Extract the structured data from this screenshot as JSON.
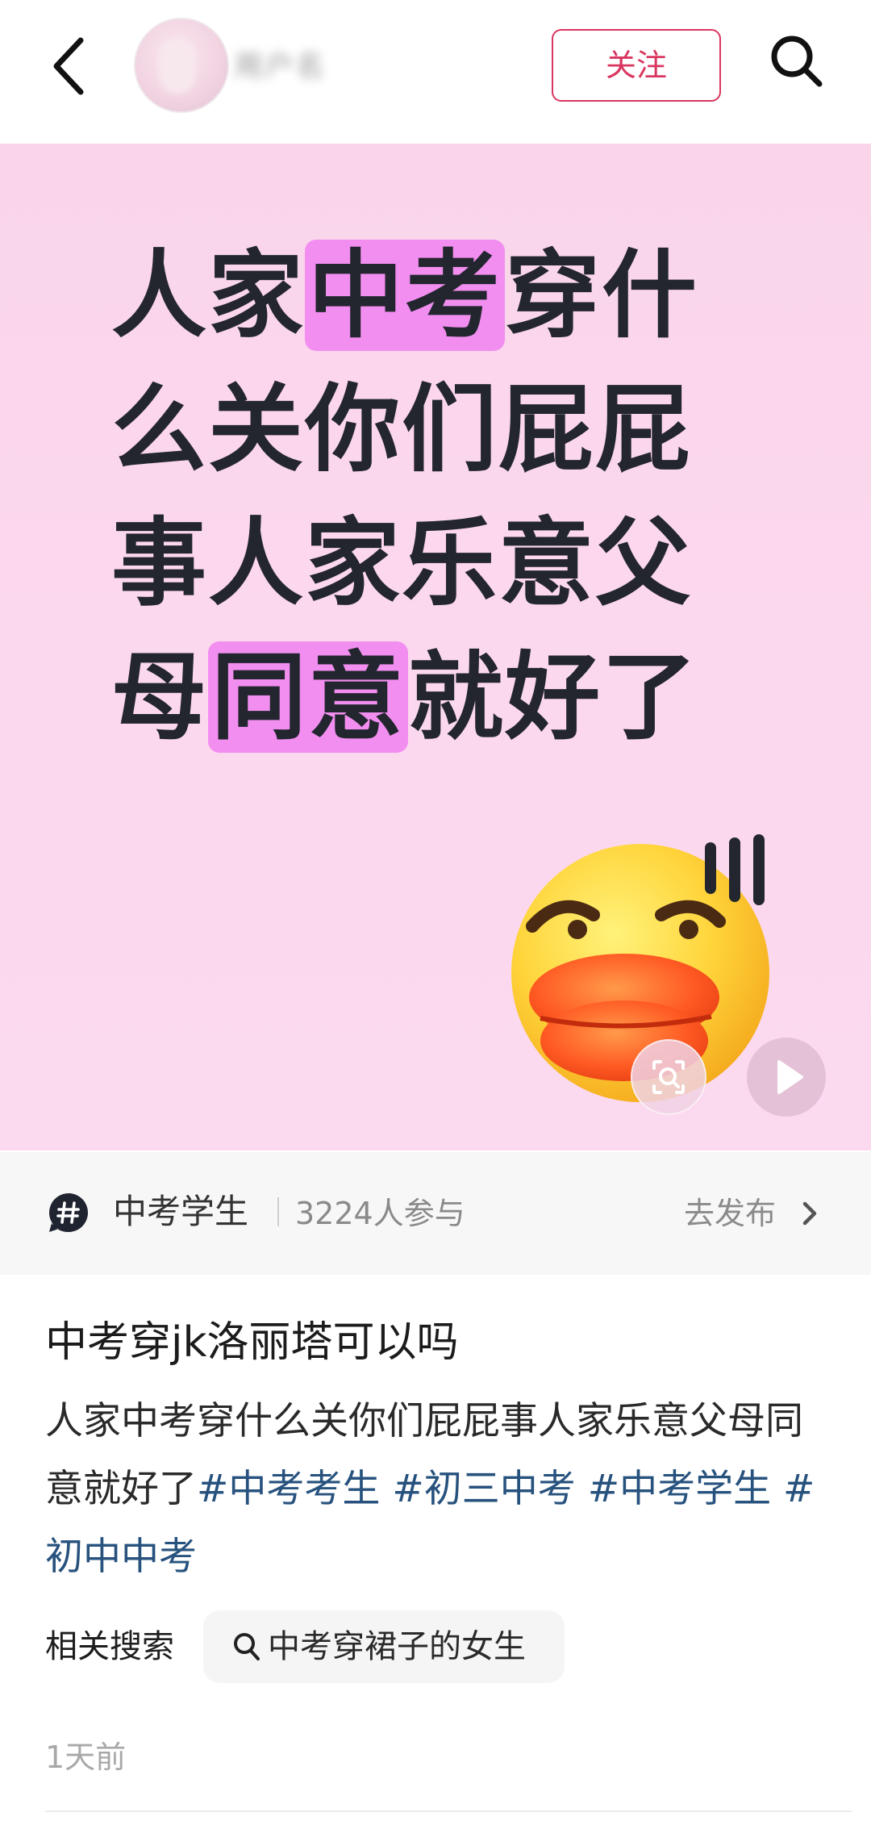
{
  "header": {
    "username": "用户名",
    "follow_label": "关注"
  },
  "hero": {
    "lines": [
      [
        "人家",
        "中考",
        "穿什"
      ],
      [
        "么关你们屁屁"
      ],
      [
        "事人家乐意父"
      ],
      [
        "母",
        "同意",
        "就好了"
      ]
    ],
    "highlight_color": "#f28ef0",
    "text_color": "#23262e"
  },
  "topic": {
    "name": "中考学生",
    "participants": "3224人参与",
    "post_action": "去发布"
  },
  "post": {
    "title": "中考穿jk洛丽塔可以吗",
    "body_text": "人家中考穿什么关你们屁屁事人家乐意父母同意就好了",
    "tags": [
      "#中考考生",
      "#初三中考",
      "#中考学生",
      "#初中中考"
    ],
    "time": "1天前"
  },
  "related": {
    "label": "相关搜索",
    "query": "中考穿裙子的女生"
  },
  "colors": {
    "accent": "#d9365f",
    "tag": "#27527e",
    "hero_bg": "#fcd8ee"
  },
  "icons": [
    "back-icon",
    "search-icon",
    "scan-icon",
    "play-icon",
    "hashtag-icon",
    "chevron-right-icon",
    "duck-emoji"
  ]
}
